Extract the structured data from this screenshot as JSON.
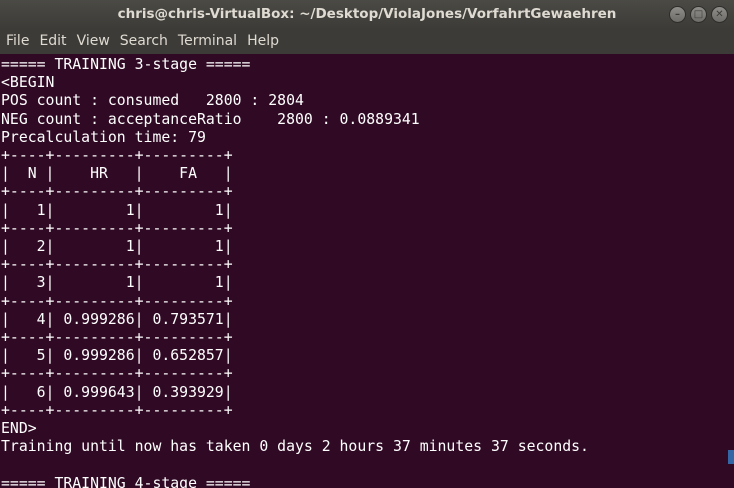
{
  "window": {
    "title": "chris@chris-VirtualBox: ~/Desktop/ViolaJones/VorfahrtGewaehren",
    "controls": {
      "minimize": "–",
      "maximize": "□",
      "close": "✕"
    }
  },
  "menubar": {
    "items": [
      "File",
      "Edit",
      "View",
      "Search",
      "Terminal",
      "Help"
    ]
  },
  "terminal": {
    "lines": [
      "===== TRAINING 3-stage =====",
      "<BEGIN",
      "POS count : consumed   2800 : 2804",
      "NEG count : acceptanceRatio    2800 : 0.0889341",
      "Precalculation time: 79",
      "+----+---------+---------+",
      "|  N |    HR   |    FA   |",
      "+----+---------+---------+",
      "|   1|        1|        1|",
      "+----+---------+---------+",
      "|   2|        1|        1|",
      "+----+---------+---------+",
      "|   3|        1|        1|",
      "+----+---------+---------+",
      "|   4| 0.999286| 0.793571|",
      "+----+---------+---------+",
      "|   5| 0.999286| 0.652857|",
      "+----+---------+---------+",
      "|   6| 0.999643| 0.393929|",
      "+----+---------+---------+",
      "END>",
      "Training until now has taken 0 days 2 hours 37 minutes 37 seconds.",
      "",
      "===== TRAINING 4-stage ====="
    ]
  },
  "colors": {
    "terminal_background": "#300a24",
    "text": "#ffffff",
    "titlebar": "#3c3b37"
  }
}
